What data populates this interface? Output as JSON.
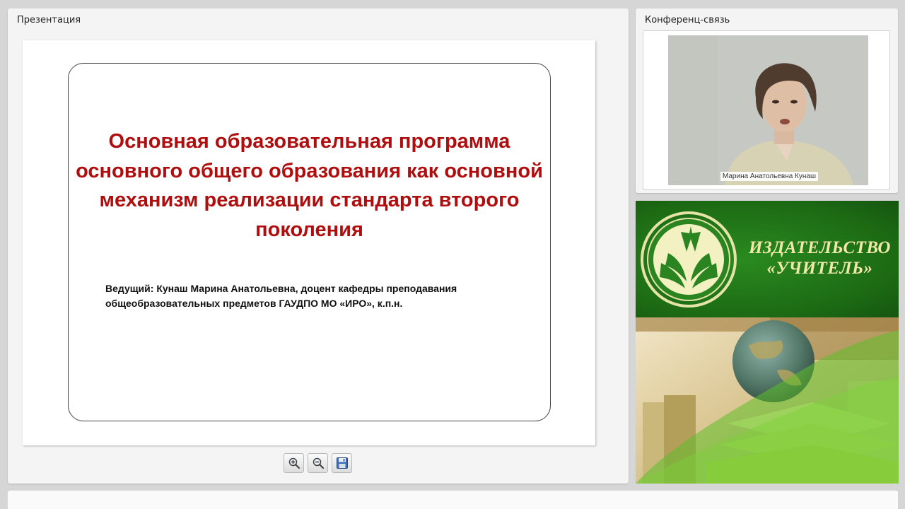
{
  "presentation": {
    "title": "Презентация",
    "slide": {
      "title": "Основная образовательная программа основного общего образования как основной механизм реализации стандарта второго поколения",
      "subtitle": "Ведущий: Кунаш Марина Анатольевна, доцент кафедры преподавания общеобразовательных предметов ГАУДПО МО «ИРО», к.п.н."
    },
    "toolbar": {
      "zoom_in_icon": "zoom-in-icon",
      "zoom_out_icon": "zoom-out-icon",
      "save_icon": "save-icon"
    }
  },
  "conference": {
    "title": "Конференц-связь",
    "speaker_name": "Марина Анатольевна Кунаш"
  },
  "banner": {
    "publisher_name": "ИЗДАТЕЛЬСТВО «УЧИТЕЛЬ»",
    "colors": {
      "green": "#1e6b17",
      "gold": "#f0e9a8"
    }
  },
  "colors": {
    "slide_title": "#b00e0e"
  }
}
